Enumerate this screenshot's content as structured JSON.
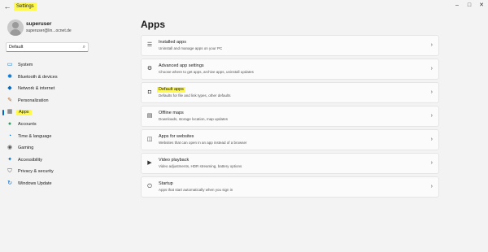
{
  "window": {
    "title": "Settings",
    "min": "–",
    "max": "□",
    "close": "✕",
    "back": "←"
  },
  "user": {
    "name": "superuser",
    "email": "superuser@lin...ocnet.de"
  },
  "search": {
    "value": "Default",
    "icon": "search-icon"
  },
  "sidebar": {
    "items": [
      {
        "label": "System",
        "icon": "system-icon",
        "glyph": "▭",
        "color": "#0067c0"
      },
      {
        "label": "Bluetooth & devices",
        "icon": "bluetooth-icon",
        "glyph": "✱",
        "color": "#0067c0"
      },
      {
        "label": "Network & internet",
        "icon": "wifi-icon",
        "glyph": "◆",
        "color": "#0067c0"
      },
      {
        "label": "Personalization",
        "icon": "brush-icon",
        "glyph": "✎",
        "color": "#c0671f"
      },
      {
        "label": "Apps",
        "icon": "apps-icon",
        "glyph": "▦",
        "color": "#555555",
        "active": true
      },
      {
        "label": "Accounts",
        "icon": "person-icon",
        "glyph": "●",
        "color": "#2aa05a"
      },
      {
        "label": "Time & language",
        "icon": "globe-icon",
        "glyph": "◔",
        "color": "#0067c0"
      },
      {
        "label": "Gaming",
        "icon": "gamepad-icon",
        "glyph": "◉",
        "color": "#555555"
      },
      {
        "label": "Accessibility",
        "icon": "accessibility-icon",
        "glyph": "✦",
        "color": "#0067c0"
      },
      {
        "label": "Privacy & security",
        "icon": "shield-icon",
        "glyph": "⛉",
        "color": "#555555"
      },
      {
        "label": "Windows Update",
        "icon": "update-icon",
        "glyph": "↻",
        "color": "#0067c0"
      }
    ]
  },
  "main": {
    "title": "Apps",
    "rows": [
      {
        "title": "Installed apps",
        "sub": "Uninstall and manage apps on your PC",
        "icon": "installed-apps-icon",
        "glyph": "☰"
      },
      {
        "title": "Advanced app settings",
        "sub": "Choose where to get apps, archive apps, uninstall updates",
        "icon": "advanced-settings-icon",
        "glyph": "⚙"
      },
      {
        "title": "Default apps",
        "sub": "Defaults for file and link types, other defaults",
        "icon": "default-apps-icon",
        "glyph": "◘",
        "highlight": true
      },
      {
        "title": "Offline maps",
        "sub": "Downloads, storage location, map updates",
        "icon": "map-icon",
        "glyph": "▤"
      },
      {
        "title": "Apps for websites",
        "sub": "Websites that can open in an app instead of a browser",
        "icon": "apps-websites-icon",
        "glyph": "◫"
      },
      {
        "title": "Video playback",
        "sub": "Video adjustments, HDR streaming, battery options",
        "icon": "video-icon",
        "glyph": "▶"
      },
      {
        "title": "Startup",
        "sub": "Apps that start automatically when you sign in",
        "icon": "startup-icon",
        "glyph": "⏻"
      }
    ],
    "chevron": "›"
  },
  "colors": {
    "highlight": "#fff94d",
    "accent": "#0067c0",
    "background": "#f3f3f3",
    "card": "#fbfbfb"
  }
}
